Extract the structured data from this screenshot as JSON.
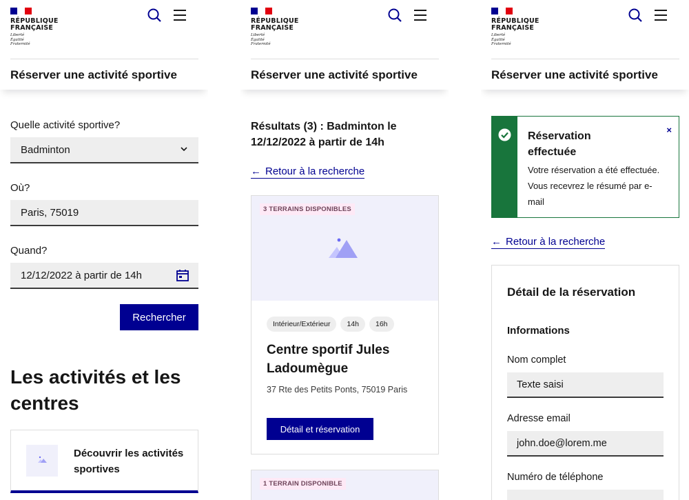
{
  "brand": {
    "republique": [
      "RÉPUBLIQUE",
      "FRANÇAISE"
    ],
    "devise": [
      "Liberté",
      "Égalité",
      "Fraternité"
    ]
  },
  "service_title": "Réserver une activité sportive",
  "colors": {
    "primary": "#000091",
    "success": "#18753c",
    "badge_bg": "#fee9f6",
    "field_bg": "#eeeeee"
  },
  "search_screen": {
    "activity_label": "Quelle activité sportive?",
    "activity_value": "Badminton",
    "location_label": "Où?",
    "location_value": "Paris, 75019",
    "date_label": "Quand?",
    "date_value": "12/12/2022 à partir de 14h",
    "search_button": "Rechercher",
    "section_title": "Les activités et les centres",
    "discover_card": "Découvrir les activités sportives"
  },
  "results_screen": {
    "title": "Résultats (3) : Badminton le 12/12/2022 à partir de 14h",
    "back_link": "Retour à la recherche",
    "cards": [
      {
        "badge": "3 TERRAINS DISPONIBLES",
        "tags": [
          "Intérieur/Extérieur",
          "14h",
          "16h"
        ],
        "title": "Centre sportif Jules Ladoumègue",
        "address": "37 Rte des Petits Ponts, 75019 Paris",
        "button": "Détail et réservation"
      },
      {
        "badge": "1 TERRAIN DISPONIBLE"
      }
    ]
  },
  "confirm_screen": {
    "alert_title": "Réservation effectuée",
    "alert_body": "Votre réservation a été effectuée. Vous recevrez le résumé par e-mail",
    "alert_close": "×",
    "back_link": "Retour à la recherche",
    "detail_title": "Détail de la réservation",
    "info_title": "Informations",
    "name_label": "Nom complet",
    "name_value": "Texte saisi",
    "email_label": "Adresse email",
    "email_value": "john.doe@lorem.me",
    "phone_label": "Numéro de téléphone"
  }
}
